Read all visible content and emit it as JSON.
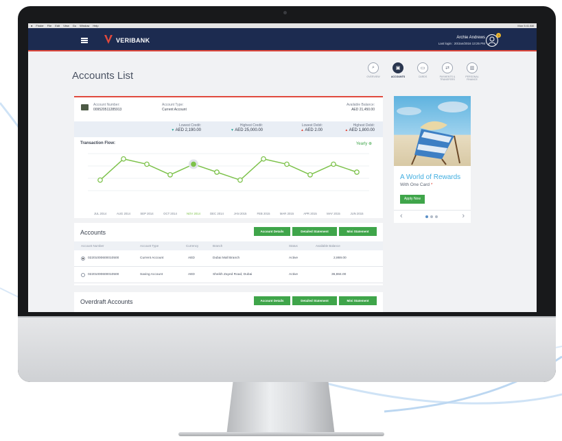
{
  "menubar": {
    "items": [
      "Finder",
      "File",
      "Edit",
      "View",
      "Go",
      "Window",
      "Help"
    ],
    "status": "Mon 5:41 AM"
  },
  "header": {
    "brand": "VERIBANK",
    "user_name": "Archie Andrews",
    "last_login": "Last login : 20/Jan/2016 13:25 PM",
    "notification_count": "3"
  },
  "page": {
    "title": "Accounts List"
  },
  "nav": [
    {
      "label": "OVERVIEW",
      "icon": "search-icon"
    },
    {
      "label": "ACCOUNTS",
      "icon": "wallet-icon",
      "active": true
    },
    {
      "label": "CARDS",
      "icon": "card-icon"
    },
    {
      "label": "PAYMENTS & TRANSFERS",
      "icon": "transfer-icon"
    },
    {
      "label": "PERSONAL FINANCE",
      "icon": "chart-icon"
    }
  ],
  "account": {
    "number_label": "Account Number:",
    "number": "009520511285913",
    "type_label": "Account Type:",
    "type": "Current Account",
    "balance_label": "Available Balance:",
    "balance": "AED 21,450.00",
    "lowest_credit_label": "Lowest Credit:",
    "lowest_credit": "AED 2,190.00",
    "highest_credit_label": "Highest Credit:",
    "highest_credit": "AED 25,000.00",
    "lowest_debit_label": "Lowest Debit:",
    "lowest_debit": "AED 2.00",
    "highest_debit_label": "Highest Debit:",
    "highest_debit": "AED 1,800.00"
  },
  "transaction_flow": {
    "title": "Transaction Flow:",
    "period": "Yearly"
  },
  "chart_data": {
    "type": "line",
    "categories": [
      "JUL 2014",
      "AUG 2014",
      "SEP 2014",
      "OCT 2014",
      "NOV 2014",
      "DEC 2014",
      "JAN 2015",
      "FEB 2015",
      "MAR 2015",
      "APR 2015",
      "MAY 2015",
      "JUN 2015"
    ],
    "values": [
      2,
      6,
      5,
      3,
      5,
      3.5,
      2,
      6,
      5,
      3,
      5,
      3.5
    ],
    "highlight_index": 4,
    "ylim": [
      0,
      7
    ],
    "line_color": "#7dc24b",
    "grid": true
  },
  "ad": {
    "title": "A World of Rewards",
    "subtitle": "With One Card",
    "button": "Apply Now",
    "prev": "‹",
    "next": "›"
  },
  "accounts": {
    "title": "Accounts",
    "buttons": [
      "Account Details",
      "Detailed Statement",
      "Mini Statement"
    ],
    "columns": [
      "Account Number",
      "Account Type",
      "Currency",
      "Branch",
      "Status",
      "Available Balance"
    ],
    "rows": [
      {
        "number": "02201000600010500",
        "type": "Current Account",
        "currency": "AED",
        "branch": "Dubai Mall Branch",
        "status": "Active",
        "balance": "2,869.00",
        "selected": true
      },
      {
        "number": "02201000600010500",
        "type": "Saving Account",
        "currency": "AED",
        "branch": "Sheikh Zayed Road, Dubai",
        "status": "Active",
        "balance": "36,884.00",
        "selected": false
      }
    ]
  },
  "overdraft": {
    "title": "Overdraft Accounts",
    "buttons": [
      "Account Details",
      "Detailed Statement",
      "Mini Statement"
    ]
  },
  "colors": {
    "navy": "#1c2b50",
    "accent_red": "#e0493c",
    "green": "#3fa54a",
    "light_blue": "#41aee0"
  }
}
